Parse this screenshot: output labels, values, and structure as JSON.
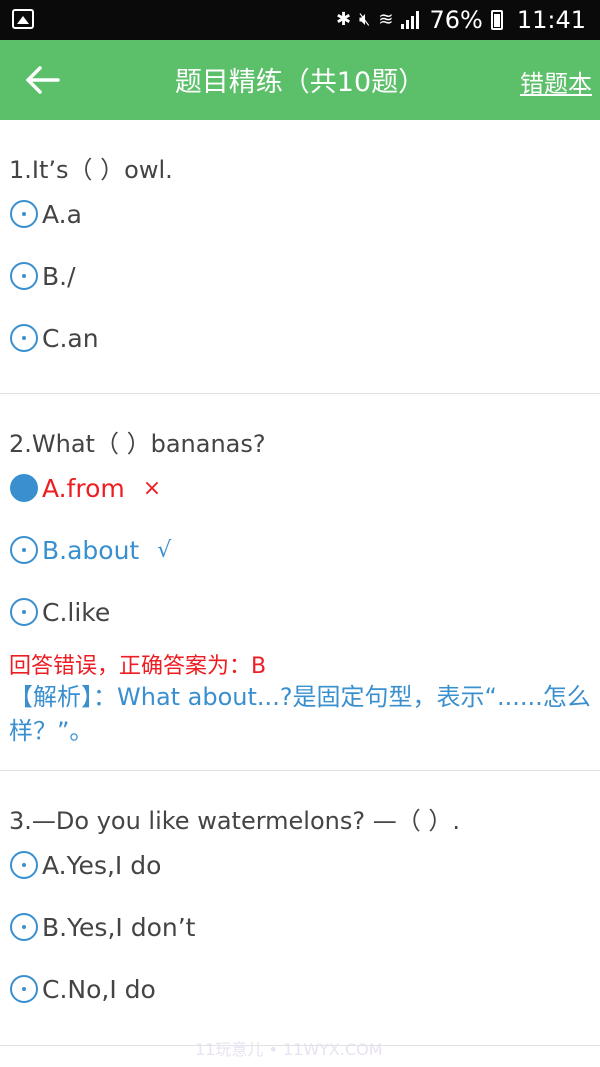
{
  "status": {
    "battery": "76%",
    "time": "11:41"
  },
  "header": {
    "title": "题目精练（共10题）",
    "wrongbook": "错题本"
  },
  "questions": [
    {
      "title": "1.It’s（ ）owl.",
      "options": [
        "A.a",
        "B./",
        "C.an"
      ]
    },
    {
      "title": "2.What（ ）bananas?",
      "options": [
        "A.from",
        "B.about",
        "C.like"
      ],
      "marks": {
        "wrong": "×",
        "right": "√"
      },
      "feedback": "回答错误，正确答案为：B",
      "analysis": "【解析】：What about...?是固定句型，表示“......怎么样？”。"
    },
    {
      "title": "3.—Do you like watermelons? —（ ）.",
      "options": [
        "A.Yes,I do",
        "B.Yes,I don’t",
        "C.No,I do"
      ]
    }
  ],
  "watermark": "11玩意儿 • 11WYX.COM"
}
